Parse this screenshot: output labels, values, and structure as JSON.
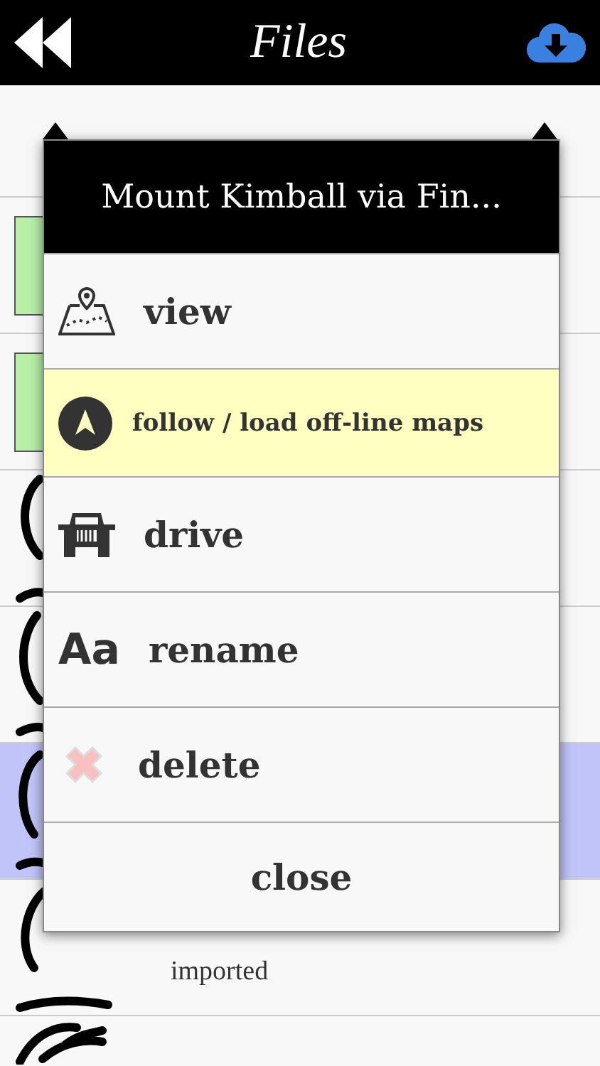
{
  "header": {
    "title": "Files"
  },
  "files": [
    {
      "kind": "map",
      "selected": false
    },
    {
      "kind": "map",
      "selected": false
    },
    {
      "kind": "track",
      "selected": false
    },
    {
      "kind": "track",
      "selected": false
    },
    {
      "kind": "track",
      "selected": true
    },
    {
      "kind": "track",
      "selected": false,
      "source": "imported"
    },
    {
      "kind": "track",
      "selected": false
    }
  ],
  "dialog": {
    "title": "Mount Kimball via Fin...",
    "actions": [
      {
        "label": "view",
        "kind": "map",
        "highlighted": false
      },
      {
        "label": "follow / load off-line maps",
        "kind": "navigate",
        "highlighted": true
      },
      {
        "label": "drive",
        "kind": "jeep",
        "highlighted": false
      },
      {
        "label": "rename",
        "kind": "glyph",
        "glyph": "Aa",
        "highlighted": false
      },
      {
        "label": "delete",
        "kind": "cross",
        "highlighted": false
      }
    ],
    "close": "close"
  }
}
